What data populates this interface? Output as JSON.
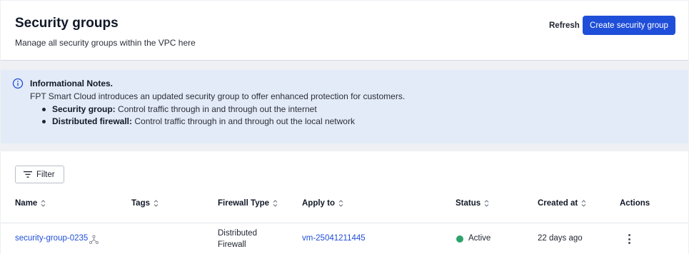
{
  "header": {
    "title": "Security groups",
    "subtitle": "Manage all security groups within the VPC here",
    "refresh_label": "Refresh",
    "create_label": "Create security group"
  },
  "notes": {
    "title": "Informational Notes.",
    "intro": "FPT Smart Cloud introduces an updated security group to offer enhanced protection for customers.",
    "items": [
      {
        "term": "Security group:",
        "text": " Control traffic through in and through out the internet"
      },
      {
        "term": "Distributed firewall:",
        "text": " Control traffic through in and through out the local network"
      }
    ]
  },
  "table": {
    "filter_label": "Filter",
    "columns": [
      "Name",
      "Tags",
      "Firewall Type",
      "Apply to",
      "Status",
      "Created at",
      "Actions"
    ],
    "rows": [
      {
        "name": "security-group-0235",
        "tags": "",
        "firewall_type_line1": "Distributed",
        "firewall_type_line2": "Firewall",
        "apply_to": "vm-25041211445",
        "status": "Active",
        "created_at": "22 days ago"
      }
    ]
  },
  "colors": {
    "primary": "#1f4ed8",
    "notes_bg": "#e3ebf8",
    "status_active": "#2ea36b"
  },
  "icons": [
    "info-icon",
    "filter-icon",
    "sort-icon",
    "group-icon",
    "more-vertical-icon"
  ]
}
